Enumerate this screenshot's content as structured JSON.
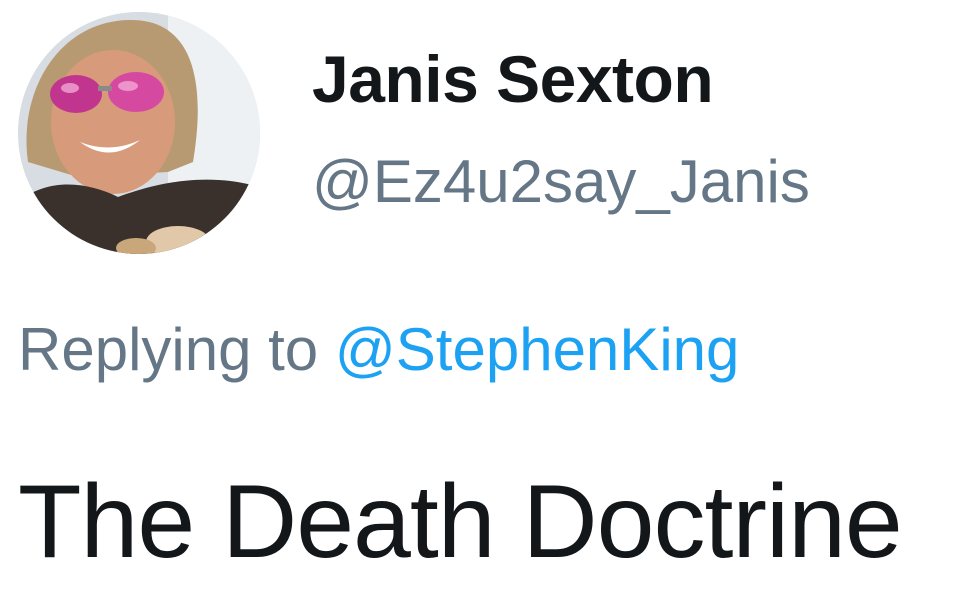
{
  "author": {
    "display_name": "Janis Sexton",
    "handle": "@Ez4u2say_Janis",
    "avatar_icon": "profile-photo"
  },
  "reply": {
    "prefix": "Replying to",
    "mention": "@StephenKing"
  },
  "tweet": {
    "text": "The Death Doctrine"
  },
  "colors": {
    "name": "#14171a",
    "secondary": "#657786",
    "link": "#1da1f2"
  }
}
